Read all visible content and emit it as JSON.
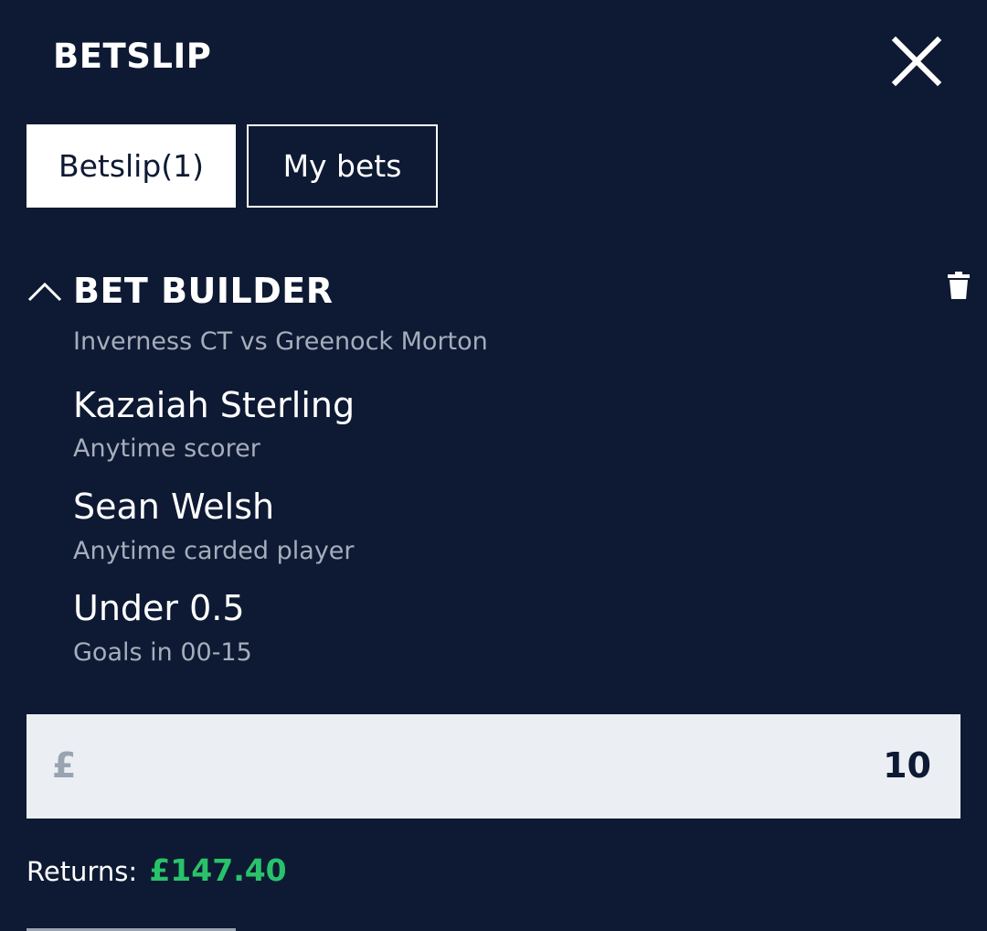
{
  "header": {
    "title": "BETSLIP",
    "close_icon": "close-icon"
  },
  "tabs": [
    {
      "label": "Betslip(1)",
      "active": true
    },
    {
      "label": "My bets",
      "active": false
    }
  ],
  "bet": {
    "title": "BET BUILDER",
    "match": "Inverness CT vs Greenock Morton",
    "collapse_icon": "chevron-up-icon",
    "delete_icon": "trash-icon",
    "selections": [
      {
        "name": "Kazaiah Sterling",
        "market": "Anytime scorer"
      },
      {
        "name": "Sean Welsh",
        "market": "Anytime carded player"
      },
      {
        "name": "Under 0.5",
        "market": "Goals in 00-15"
      }
    ]
  },
  "stake": {
    "currency": "£",
    "value": "10"
  },
  "returns": {
    "label": "Returns:",
    "value": "£147.40"
  },
  "colors": {
    "background": "#0e1a33",
    "returns_accent": "#29c26a",
    "stake_background": "#ebeff4"
  }
}
